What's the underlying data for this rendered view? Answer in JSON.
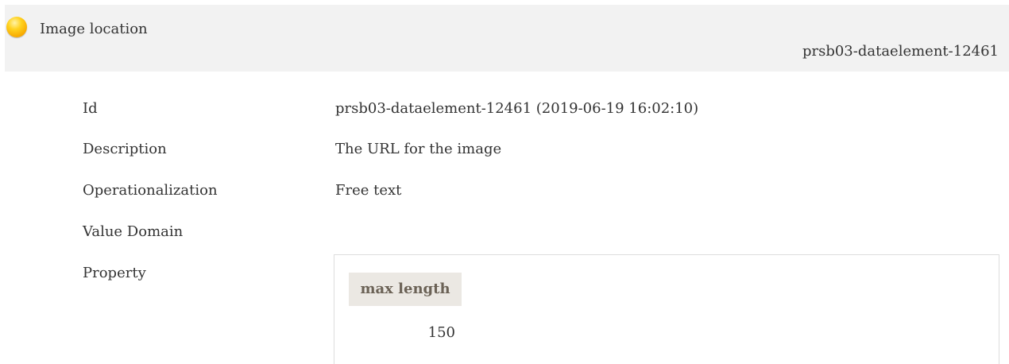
{
  "header": {
    "status_icon": "yellow-status-circle",
    "title": "Image location",
    "element_id": "prsb03-dataelement-12461"
  },
  "details": {
    "id_label": "Id",
    "id_value": "prsb03-dataelement-12461 (2019-06-19 16:02:10)",
    "description_label": "Description",
    "description_value": "The URL for the image",
    "operationalization_label": "Operationalization",
    "operationalization_value": "Free text",
    "value_domain_label": "Value Domain",
    "property_label": "Property"
  },
  "property_table": {
    "header": "max length",
    "value": "150"
  },
  "colors": {
    "header_bg": "#f2f2f2",
    "table_header_bg": "#ebe8e3",
    "table_header_text": "#6b6256",
    "status_yellow": "#ffd21f"
  }
}
